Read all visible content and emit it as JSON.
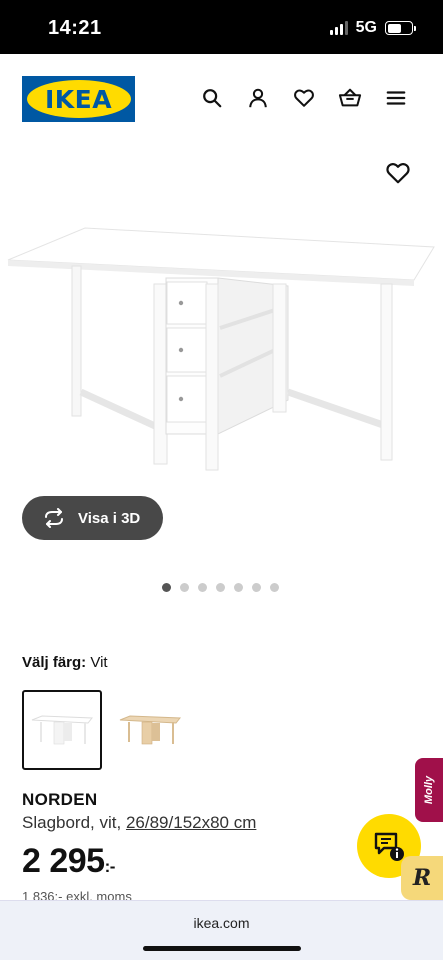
{
  "status_bar": {
    "time": "14:21",
    "network": "5G"
  },
  "header": {
    "logo_text": "IKEA"
  },
  "nav": {
    "icons": [
      "search-icon",
      "account-icon",
      "favorites-icon",
      "cart-icon",
      "menu-icon"
    ]
  },
  "gallery": {
    "view_3d_label": "Visa i 3D",
    "dot_count": 7,
    "active_dot": 1
  },
  "color_selector": {
    "label": "Välj färg:",
    "selected_value": "Vit",
    "options": [
      "white",
      "birch"
    ]
  },
  "product": {
    "name": "NORDEN",
    "description": "Slagbord, vit,",
    "dimensions": "26/89/152x80 cm",
    "price": "2 295",
    "price_suffix": ":-",
    "price_excl": "1 836:- exkl. moms"
  },
  "widgets": {
    "molly_label": "Molly",
    "r_label": "R"
  },
  "browser": {
    "url": "ikea.com"
  },
  "colors": {
    "ikea_blue": "#0058a3",
    "ikea_yellow": "#ffdb00",
    "button_dark": "#484848"
  }
}
